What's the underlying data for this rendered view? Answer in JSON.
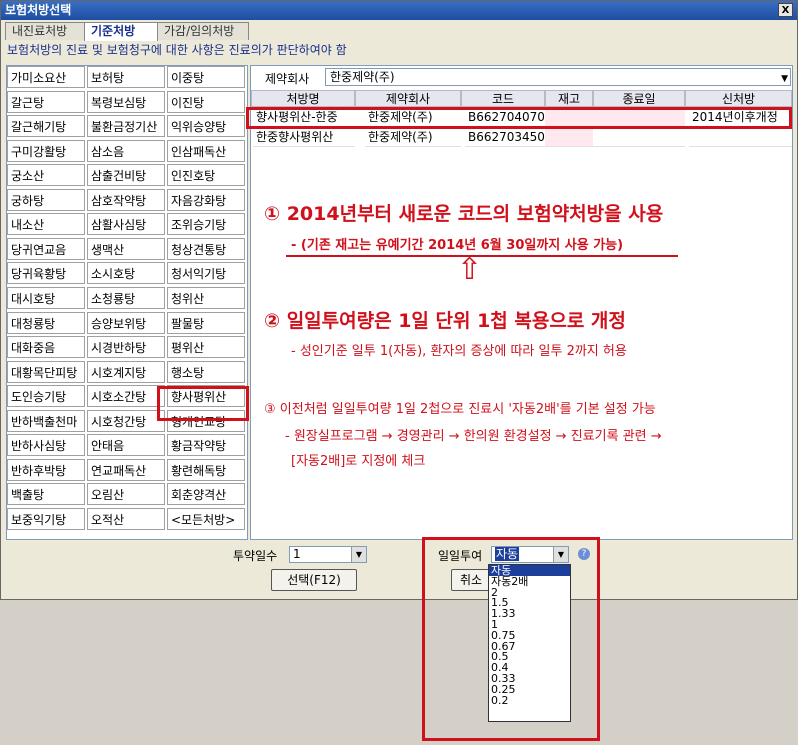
{
  "window": {
    "title": "보험처방선택",
    "close": "X"
  },
  "tabs": [
    "내진료처방",
    "기준처방",
    "가감/임의처방"
  ],
  "notice": "보험처방의 진료 및 보험청구에 대한 사항은 진료의가 판단하여야 함",
  "prescriptions": [
    [
      "가미소요산",
      "보허탕",
      "이중탕"
    ],
    [
      "갈근탕",
      "복령보심탕",
      "이진탕"
    ],
    [
      "갈근해기탕",
      "불환금정기산",
      "익위승양탕"
    ],
    [
      "구미강활탕",
      "삼소음",
      "인삼패독산"
    ],
    [
      "궁소산",
      "삼출건비탕",
      "인진호탕"
    ],
    [
      "궁하탕",
      "삼호작약탕",
      "자음강화탕"
    ],
    [
      "내소산",
      "삼활사심탕",
      "조위승기탕"
    ],
    [
      "당귀연교음",
      "생맥산",
      "청상견통탕"
    ],
    [
      "당귀육황탕",
      "소시호탕",
      "청서익기탕"
    ],
    [
      "대시호탕",
      "소청룡탕",
      "청위산"
    ],
    [
      "대청룡탕",
      "승양보위탕",
      "팔물탕"
    ],
    [
      "대화중음",
      "시경반하탕",
      "평위산"
    ],
    [
      "대황목단피탕",
      "시호계지탕",
      "행소탕"
    ],
    [
      "도인승기탕",
      "시호소간탕",
      "향사평위산"
    ],
    [
      "반하백출천마",
      "시호청간탕",
      "형개연교탕"
    ],
    [
      "반하사심탕",
      "안태음",
      "황금작약탕"
    ],
    [
      "반하후박탕",
      "연교패독산",
      "황련해독탕"
    ],
    [
      "백출탕",
      "오림산",
      "회춘양격산"
    ],
    [
      "보중익기탕",
      "오적산",
      "<모든처방>"
    ]
  ],
  "company": {
    "label": "제약회사",
    "value": "한중제약(주)"
  },
  "table": {
    "headers": [
      "처방명",
      "제약회사",
      "코드",
      "재고",
      "종료일",
      "신처방"
    ],
    "rows": [
      [
        "향사평위산-한중",
        "한중제약(주)",
        "B662704070",
        "",
        "",
        "2014년이후개정"
      ],
      [
        "한중향사평위산",
        "한중제약(주)",
        "B662703450",
        "",
        "",
        ""
      ]
    ]
  },
  "annotations": {
    "a1": "① 2014년부터 새로운 코드의 보험약처방을 사용",
    "a1_sub": "- (기존 재고는 유예기간 2014년 6월 30일까지 사용 가능)",
    "arrow": "⇧",
    "a2": "② 일일투여량은 1일 단위 1첩 복용으로 개정",
    "a2_sub": "- 성인기준 일투 1(자동), 환자의 증상에 따라 일투 2까지 허용",
    "a3": "③ 이전처럼 일일투여량 1일 2첩으로 진료시 '자동2배'를 기본 설정 가능",
    "a3_sub1": "- 원장실프로그램 → 경영관리 →  한의원 환경설정 → 진료기록 관련 →",
    "a3_sub2": "[자동2배]로 지정에 체크"
  },
  "bottom": {
    "days_label": "투약일수",
    "days_value": "1",
    "dose_label": "일일투여",
    "dose_value": "자동",
    "select_button": "선택(F12)",
    "cancel_button": "취소",
    "help": "?"
  },
  "dose_options": [
    "자동",
    "자동2배",
    "2",
    "1.5",
    "1.33",
    "1",
    "0.75",
    "0.67",
    "0.5",
    "0.4",
    "0.33",
    "0.25",
    "0.2"
  ],
  "colors": {
    "annotation": "#d0101a",
    "accent": "#1a2f8c",
    "selected": "#1d3f9c"
  }
}
